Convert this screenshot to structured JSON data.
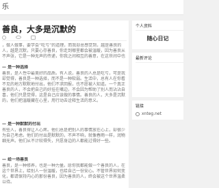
{
  "header": {
    "site_name_fragment": "乐"
  },
  "article": {
    "title": "善良，大多是沉默的",
    "meta_icons": [
      "clock-icon",
      "eye-icon",
      "folder-icon"
    ],
    "intro": "，做人做事，要学会“吃亏”的道理，而我却总感觉到，越是善良的人，越是沉默，只要心存善良，你走到哪里都会被温暖，因为善良从不声张，它是一种无声的传递，你我之间相互的善意，在这世间中也会温暖每一个人。",
    "sections": [
      {
        "heading": "— 是一种选择",
        "text": "善良，是人性中最美好的品质。有人说，善良的人总是吃亏，可是我却觉得，善良是一种选择，而不是一种软弱。生活中，总有人在你看不见的地方默默地付出，他们不求回报，也不愿被人知道。一个真正善良的人，不会把自己的好挂在嘴边，不会因为帮助了别人而沾沾自喜，他们只是觉得，这是自己应该做的事情。善良的人，大多是沉默的，他们把温暖藏在心里，用行动去诠释生活的意义。"
      },
      {
        "heading": "— 是一种默默的付出",
        "text": "有些人，善良得让人心疼。他们总是把别人的事情放在心上，却很少为自己考虑。他们的付出是默默的，不声不响，就像春雨一样，润物细无声。他们从不计较得失，只愿身边的人都能过得好一些。"
      },
      {
        "heading": "— 给一场善良",
        "text": "善良，是一种修养，也是一种力量。愿你我都能做一个善良的人，在这个世界上，给别人一份温暖，也给自己一份安心。不管世界如何变化，都请保持内心的那份善良，因为善良的人，终会被这个世界温柔以待。"
      }
    ]
  },
  "sidebar": {
    "profile": {
      "heading": "个人资料",
      "name": "随心日记"
    },
    "comments": {
      "heading": "最新评论"
    },
    "links": {
      "heading": "链接",
      "items": [
        {
          "label": "xnteg.net",
          "icon": "link-icon"
        }
      ]
    }
  },
  "colors": {
    "page_background": "#f1f1f1",
    "card_background": "#ffffff",
    "title_text": "#222222",
    "body_text": "#777777"
  }
}
